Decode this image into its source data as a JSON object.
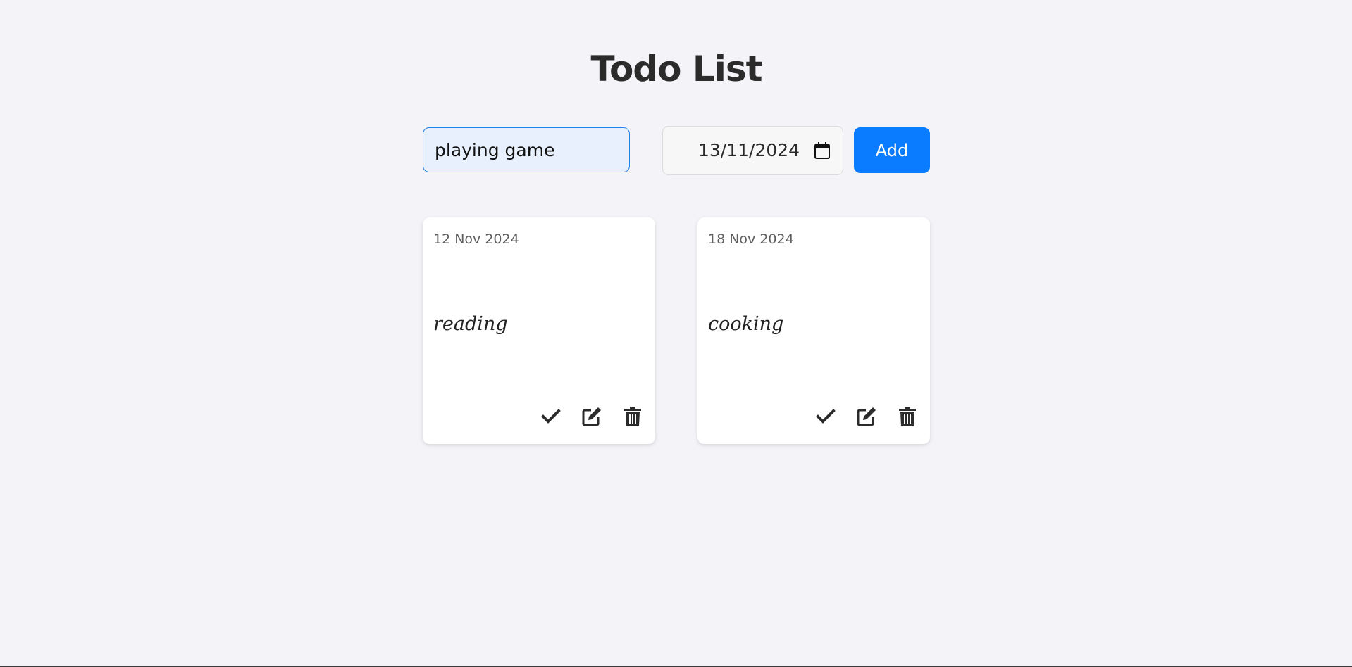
{
  "header": {
    "title": "Todo List"
  },
  "form": {
    "task_value": "playing game",
    "date_value": "13/11/2024",
    "add_label": "Add"
  },
  "todos": [
    {
      "date": "12 Nov 2024",
      "text": "reading"
    },
    {
      "date": "18 Nov 2024",
      "text": "cooking"
    }
  ],
  "icons": {
    "complete": "check-icon",
    "edit": "edit-icon",
    "delete": "trash-icon",
    "date_picker": "calendar-icon"
  },
  "colors": {
    "background": "#f3f3f8",
    "accent": "#0a7cff",
    "input_focus_border": "#1f82e8",
    "input_focus_bg": "#e8f0fd",
    "card_bg": "#ffffff",
    "text": "#2f2f2f"
  }
}
